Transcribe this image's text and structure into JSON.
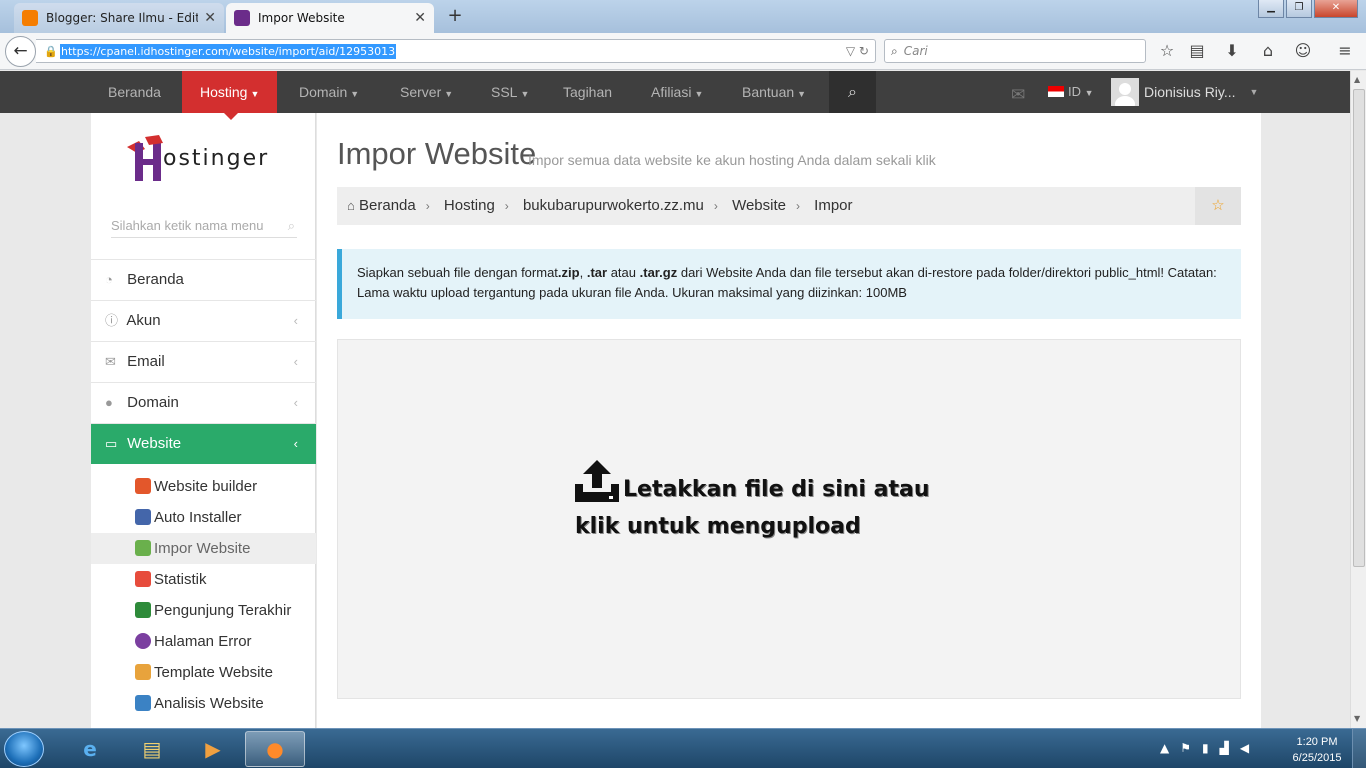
{
  "browser": {
    "tabs": [
      {
        "title": "Blogger: Share Ilmu - Edit e...",
        "active": false
      },
      {
        "title": "Impor Website",
        "active": true
      }
    ],
    "url": "https://cpanel.idhostinger.com/website/import/aid/12953013",
    "search_placeholder": "Cari"
  },
  "topnav": {
    "items": [
      {
        "label": "Beranda",
        "caret": false
      },
      {
        "label": "Hosting",
        "caret": true
      },
      {
        "label": "Domain",
        "caret": true
      },
      {
        "label": "Server",
        "caret": true
      },
      {
        "label": "SSL",
        "caret": true
      },
      {
        "label": "Tagihan",
        "caret": false
      },
      {
        "label": "Afiliasi",
        "caret": true
      },
      {
        "label": "Bantuan",
        "caret": true
      }
    ],
    "active_index": 1,
    "language": "ID",
    "user_name": "Dionisius Riy..."
  },
  "sidebar": {
    "logo_text": "ostinger",
    "search_placeholder": "Silahkan ketik nama menu",
    "menu": [
      {
        "label": "Beranda",
        "icon": "dashboard-icon"
      },
      {
        "label": "Akun",
        "icon": "info-icon"
      },
      {
        "label": "Email",
        "icon": "envelope-icon"
      },
      {
        "label": "Domain",
        "icon": "globe-icon"
      },
      {
        "label": "Website",
        "icon": "monitor-icon",
        "active": true
      }
    ],
    "submenu": [
      {
        "label": "Website builder",
        "color": "#e3572b"
      },
      {
        "label": "Auto Installer",
        "color": "#4466aa"
      },
      {
        "label": "Impor Website",
        "color": "#6ab04c",
        "selected": true
      },
      {
        "label": "Statistik",
        "color": "#e74c3c"
      },
      {
        "label": "Pengunjung Terakhir",
        "color": "#2e8b3a"
      },
      {
        "label": "Halaman Error",
        "color": "#7b3fa0"
      },
      {
        "label": "Template Website",
        "color": "#e8a33c"
      },
      {
        "label": "Analisis Website",
        "color": "#3b82c4"
      }
    ]
  },
  "main": {
    "title": "Impor Website",
    "subtitle": "Impor semua data website ke akun hosting Anda dalam sekali klik",
    "breadcrumb": [
      "Beranda",
      "Hosting",
      "bukubarupurwokerto.zz.mu",
      "Website",
      "Impor"
    ],
    "alert": {
      "p1": "Siapkan sebuah file dengan format",
      "zip": ".zip",
      "comma": ",",
      "tar": ".tar",
      "atau": "atau",
      "targz": ".tar.gz",
      "p2": "dari Website Anda dan file tersebut akan di-restore pada folder/direktori public_html! Catatan: Lama waktu upload tergantung pada ukuran file Anda. Ukuran maksimal yang diizinkan: 100MB"
    },
    "dropzone_text": "Letakkan file di sini atau klik untuk mengupload"
  },
  "taskbar": {
    "time": "1:20 PM",
    "date": "6/25/2015"
  },
  "colors": {
    "nav_bg": "#3f3f3f",
    "nav_active": "#d32f2f",
    "sidebar_active": "#2aaa6a",
    "alert_bg": "#e4f3f9",
    "alert_border": "#3aa8da"
  }
}
